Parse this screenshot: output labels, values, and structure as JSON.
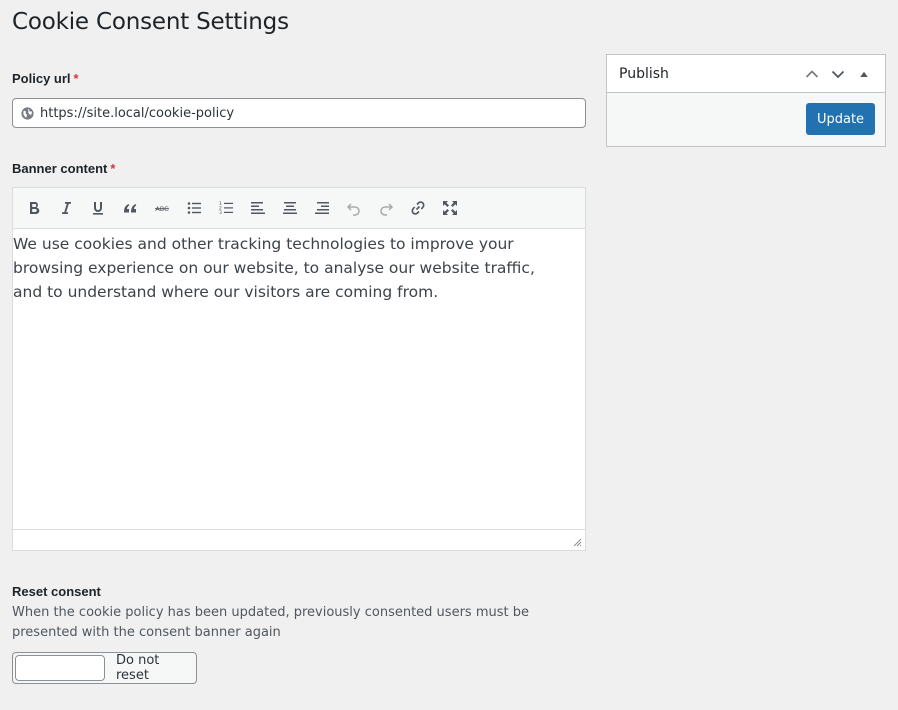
{
  "page": {
    "title": "Cookie Consent Settings"
  },
  "policy_url": {
    "label": "Policy url",
    "required_marker": "*",
    "value": "https://site.local/cookie-policy"
  },
  "banner": {
    "label": "Banner content",
    "required_marker": "*",
    "content": "We use cookies and other tracking technologies to improve your browsing experience on our website, to analyse our website traffic, and to understand where our visitors are coming from.",
    "toolbar": [
      "bold",
      "italic",
      "underline",
      "blockquote",
      "strikethrough",
      "bullet-list",
      "numbered-list",
      "align-left",
      "align-center",
      "align-right",
      "undo",
      "redo",
      "link",
      "fullscreen"
    ]
  },
  "reset": {
    "label": "Reset consent",
    "description": "When the cookie policy has been updated, previously consented users must be presented with the consent banner again",
    "input_value": "",
    "option_text": "Do not reset"
  },
  "publish": {
    "title": "Publish",
    "update_label": "Update"
  },
  "colors": {
    "background": "#f0f0f1",
    "primary_button": "#2271b1",
    "required": "#d63638"
  }
}
